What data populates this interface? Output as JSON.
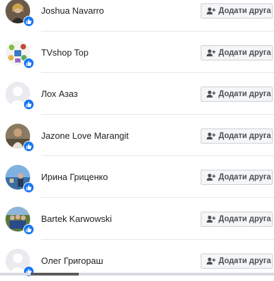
{
  "people": [
    {
      "name": "Joshua Navarro",
      "add_label": "Додати друга",
      "avatar": "avatar-photo-woman"
    },
    {
      "name": "TVshop Top",
      "add_label": "Додати друга",
      "avatar": "avatar-photo-products"
    },
    {
      "name": "Лох Азаз",
      "add_label": "Додати друга",
      "avatar": "avatar-default-silhouette"
    },
    {
      "name": "Jazone Love Marangit",
      "add_label": "Додати друга",
      "avatar": "avatar-photo-person"
    },
    {
      "name": "Ирина Гриценко",
      "add_label": "Додати друга",
      "avatar": "avatar-photo-seaside"
    },
    {
      "name": "Bartek Karwowski",
      "add_label": "Додати друга",
      "avatar": "avatar-photo-group"
    },
    {
      "name": "Олег Григораш",
      "add_label": "Додати друга",
      "avatar": "avatar-default-silhouette"
    }
  ],
  "icons": {
    "badge": "like-thumb-icon",
    "button": "add-friend-icon"
  },
  "colors": {
    "accent": "#1877f2",
    "text": "#1c1e21",
    "button_bg": "#f5f6f7",
    "button_border": "#ccd0d5",
    "button_text": "#4b4f56"
  }
}
